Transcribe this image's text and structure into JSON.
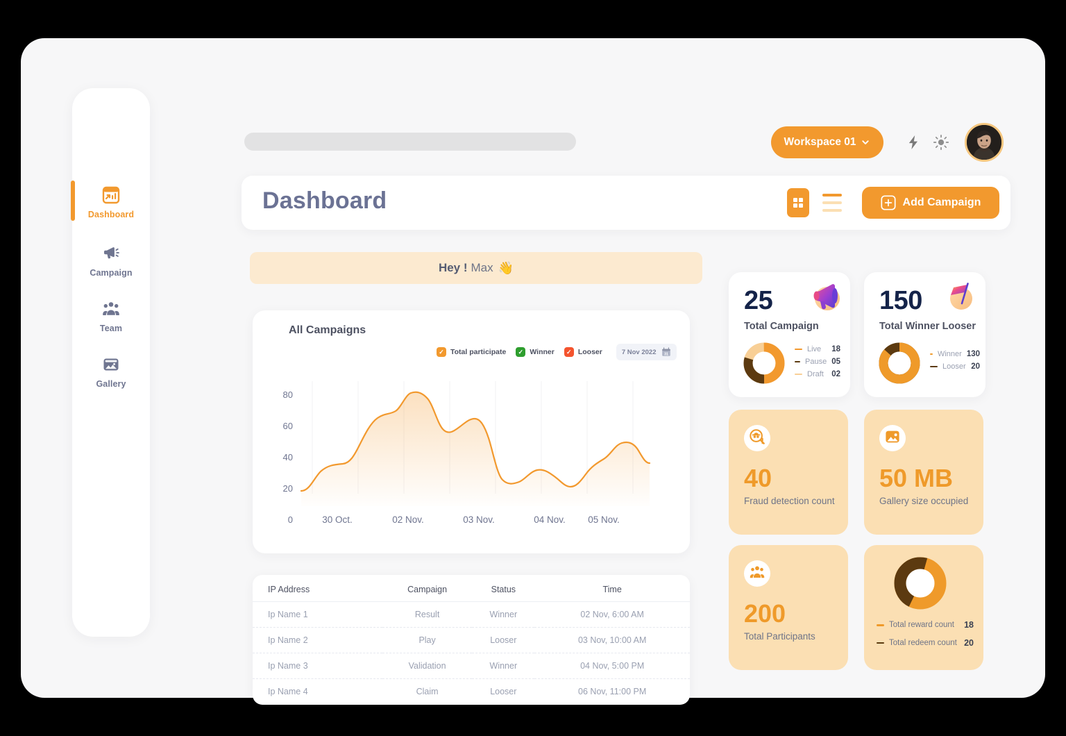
{
  "app": {
    "page_title": "Dashboard"
  },
  "topbar": {
    "search_placeholder": "",
    "workspace_label": "Workspace 01",
    "chevron_icon": "chevron-down-icon",
    "bolt_icon": "lightning-bolt-icon",
    "sun_icon": "sun-icon",
    "avatar_icon": "user-avatar"
  },
  "titlebar": {
    "title": "Dashboard",
    "grid_view_icon": "grid-view-icon",
    "list_view_icon": "list-view-icon",
    "add_campaign_label": "Add Campaign",
    "add_icon": "plus-square-icon"
  },
  "sidebar": {
    "items": [
      {
        "label": "Dashboard",
        "icon": "dashboard-chart-icon",
        "active": true
      },
      {
        "label": "Campaign",
        "icon": "megaphone-icon",
        "active": false
      },
      {
        "label": "Team",
        "icon": "people-group-icon",
        "active": false
      },
      {
        "label": "Gallery",
        "icon": "image-icon",
        "active": false
      }
    ]
  },
  "greeting": {
    "hey": "Hey !",
    "name": "Max",
    "emoji": "👋"
  },
  "chart_data": {
    "type": "area",
    "title": "All Campaigns",
    "xlabel": "",
    "ylabel": "",
    "ylim": [
      0,
      90
    ],
    "yticks": [
      "0",
      "20",
      "40",
      "60",
      "80"
    ],
    "ytick_values": [
      0,
      20,
      40,
      60,
      80
    ],
    "xticks": [
      "30 Oct.",
      "02 Nov.",
      "03 Nov.",
      "04 Nov.",
      "05 Nov."
    ],
    "grid": "vertical",
    "legend_position": "top-right",
    "legend": [
      {
        "label": "Total participate",
        "color": "#f2992e",
        "checked": true
      },
      {
        "label": "Winner",
        "color": "#2e9e2e",
        "checked": true
      },
      {
        "label": "Looser",
        "color": "#f4542e",
        "checked": true
      }
    ],
    "date_filter": {
      "label": "7 Nov 2022",
      "icon": "calendar-icon",
      "day": "31"
    },
    "series": [
      {
        "name": "Total participate",
        "color": "#f2992e",
        "x": [
          0,
          1,
          2,
          3,
          4,
          5,
          6,
          7,
          8,
          9,
          10,
          11,
          12,
          13,
          14,
          15,
          16,
          17,
          18
        ],
        "values": [
          24,
          30,
          40,
          43,
          43,
          55,
          66,
          67,
          76,
          82,
          81,
          68,
          57,
          58,
          64,
          65,
          50,
          33,
          28,
          31,
          35,
          34,
          29,
          26,
          27,
          34,
          39,
          41,
          48,
          55,
          54,
          47,
          41,
          41
        ]
      }
    ]
  },
  "table": {
    "columns": [
      "IP Address",
      "Campaign",
      "Status",
      "Time"
    ],
    "rows": [
      {
        "ip": "Ip Name 1",
        "campaign": "Result",
        "status": "Winner",
        "time": "02 Nov, 6:00 AM"
      },
      {
        "ip": "Ip Name 2",
        "campaign": "Play",
        "status": "Looser",
        "time": "03 Nov, 10:00 AM"
      },
      {
        "ip": "Ip Name 3",
        "campaign": "Validation",
        "status": "Winner",
        "time": "04 Nov, 5:00 PM"
      },
      {
        "ip": "Ip Name 4",
        "campaign": "Claim",
        "status": "Looser",
        "time": "06 Nov, 11:00 PM"
      }
    ]
  },
  "stats": {
    "total_campaign": {
      "value": "25",
      "caption": "Total Campaign",
      "icon": "megaphone-3d-icon",
      "breakdown": [
        {
          "label": "Live",
          "value": "18",
          "color": "#f2992e"
        },
        {
          "label": "Pause",
          "value": "05",
          "color": "#5c3a10"
        },
        {
          "label": "Draft",
          "value": "02",
          "color": "#f8cf96"
        }
      ]
    },
    "total_winner_looser": {
      "value": "150",
      "caption": "Total Winner Looser",
      "icon": "flag-3d-icon",
      "breakdown": [
        {
          "label": "Winner",
          "value": "130",
          "color": "#ef9a2a"
        },
        {
          "label": "Looser",
          "value": "20",
          "color": "#5c3a10"
        }
      ]
    },
    "fraud_detection": {
      "value": "40",
      "caption": "Fraud detection count",
      "icon": "fraud-detect-icon"
    },
    "gallery_size": {
      "value": "50 MB",
      "caption": "Gallery size occupied",
      "icon": "image-icon"
    },
    "total_participants": {
      "value": "200",
      "caption": "Total Participants",
      "icon": "people-group-icon"
    },
    "reward_redeem": {
      "breakdown": [
        {
          "label": "Total reward count",
          "value": "18",
          "color": "#ef9a2a"
        },
        {
          "label": "Total redeem count",
          "value": "20",
          "color": "#5c3a10"
        }
      ]
    }
  },
  "colors": {
    "accent": "#f2992e",
    "accent_dark": "#5c3a10",
    "accent_light": "#fbdfb3",
    "title": "#6b7294",
    "navy": "#142349"
  }
}
